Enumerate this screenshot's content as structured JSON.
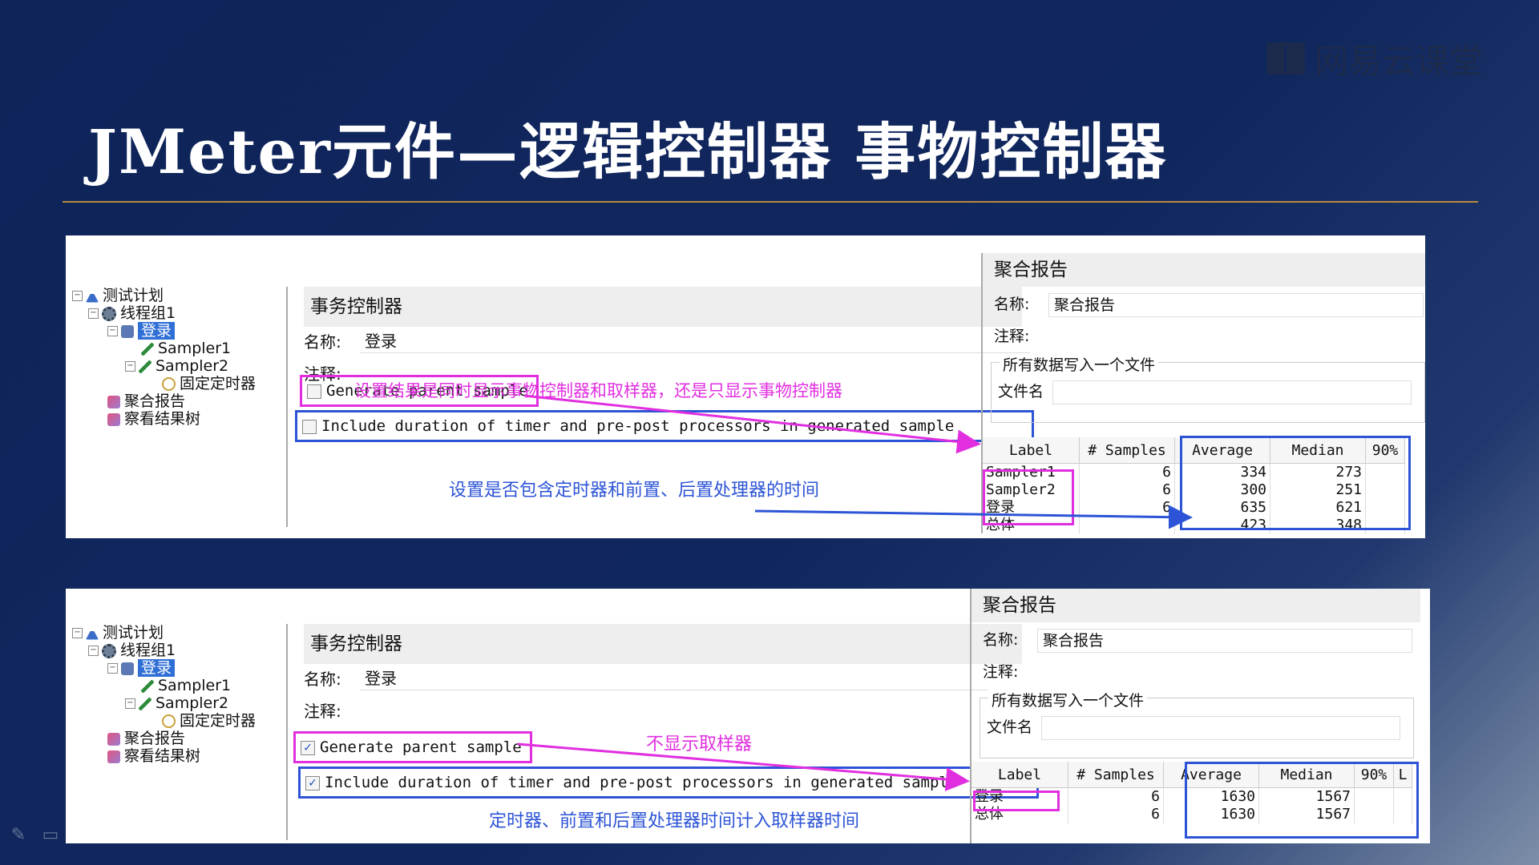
{
  "brand": {
    "logo_text": "网易云课堂"
  },
  "slide": {
    "title": "JMeter元件—逻辑控制器  事物控制器"
  },
  "panels": [
    {
      "tree": [
        "测试计划",
        "线程组1",
        "登录",
        "Sampler1",
        "Sampler2",
        "固定定时器",
        "聚合报告",
        "察看结果树"
      ],
      "form": {
        "title": "事务控制器",
        "name_label": "名称:",
        "name_value": "登录",
        "comment_label": "注释:",
        "generate_parent_label": "Generate parent sample",
        "generate_parent_checked": false,
        "include_duration_label": "Include duration of timer and pre-post processors in generated sample",
        "include_duration_checked": false
      },
      "report": {
        "title": "聚合报告",
        "name_label": "名称:",
        "name_value": "聚合报告",
        "comment_label": "注释:",
        "group_label": "所有数据写入一个文件",
        "file_label": "文件名",
        "columns": [
          "Label",
          "# Samples",
          "Average",
          "Median",
          "90%"
        ],
        "rows": [
          {
            "label": "Sampler1",
            "samples": "6",
            "average": "334",
            "median": "273"
          },
          {
            "label": "Sampler2",
            "samples": "6",
            "average": "300",
            "median": "251"
          },
          {
            "label": "登录",
            "samples": "6",
            "average": "635",
            "median": "621"
          },
          {
            "label": "总体",
            "samples": "",
            "average": "423",
            "median": "348"
          }
        ]
      },
      "annotations": {
        "magenta": "设置结果是同时显示事物控制器和取样器，还是只显示事物控制器",
        "blue": "设置是否包含定时器和前置、后置处理器的时间"
      }
    },
    {
      "tree": [
        "测试计划",
        "线程组1",
        "登录",
        "Sampler1",
        "Sampler2",
        "固定定时器",
        "聚合报告",
        "察看结果树"
      ],
      "form": {
        "title": "事务控制器",
        "name_label": "名称:",
        "name_value": "登录",
        "comment_label": "注释:",
        "generate_parent_label": "Generate parent sample",
        "generate_parent_checked": true,
        "include_duration_label": "Include duration of timer and pre-post processors in generated sample",
        "include_duration_checked": true
      },
      "report": {
        "title": "聚合报告",
        "name_label": "名称:",
        "name_value": "聚合报告",
        "comment_label": "注释:",
        "group_label": "所有数据写入一个文件",
        "file_label": "文件名",
        "columns": [
          "Label",
          "# Samples",
          "Average",
          "Median",
          "90%",
          "L"
        ],
        "rows": [
          {
            "label": "登录",
            "samples": "6",
            "average": "1630",
            "median": "1567"
          },
          {
            "label": "总体",
            "samples": "6",
            "average": "1630",
            "median": "1567"
          }
        ]
      },
      "annotations": {
        "magenta": "不显示取样器",
        "blue": "定时器、前置和后置处理器时间计入取样器时间"
      }
    }
  ],
  "colors": {
    "background": "#0f2459",
    "rule": "#b98a3c",
    "magenta": "#e12fe0",
    "blue": "#2d54d6"
  },
  "toolbar_icons": [
    "pen-icon",
    "screen-icon",
    "eraser-icon",
    "highlighter-icon",
    "pointer-icon"
  ]
}
